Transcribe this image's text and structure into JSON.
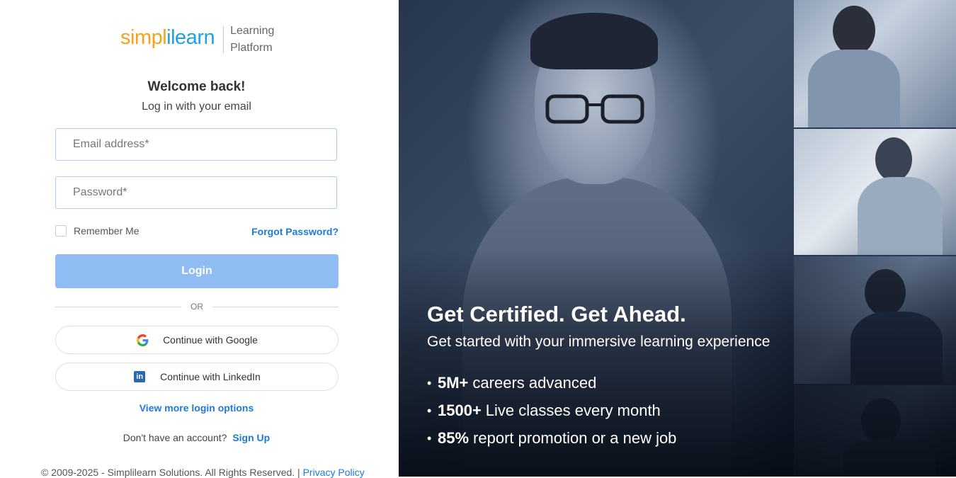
{
  "brand": {
    "logo_orange": "simpl",
    "logo_blue": "ilearn",
    "subtitle_line1": "Learning",
    "subtitle_line2": "Platform",
    "colors": {
      "orange": "#f7a21b",
      "blue": "#1fa2e0",
      "link": "#1d7ad9",
      "login_button": "#8fbcf3"
    }
  },
  "form": {
    "welcome": "Welcome back!",
    "subtitle": "Log in with your email",
    "email_placeholder": "Email address*",
    "email_value": "",
    "password_placeholder": "Password*",
    "password_value": "",
    "remember_label": "Remember Me",
    "remember_checked": false,
    "forgot_label": "Forgot Password?",
    "login_label": "Login",
    "or_label": "OR",
    "google_label": "Continue with Google",
    "google_icon": "google-g-icon",
    "linkedin_label": "Continue with LinkedIn",
    "linkedin_icon": "linkedin-icon",
    "more_options_label": "View more login options",
    "no_account_text": "Don't have an account?",
    "signup_label": "Sign Up"
  },
  "footer": {
    "copyright": "© 2009-2025 - Simplilearn Solutions. All Rights Reserved. |",
    "privacy_label": "Privacy Policy"
  },
  "hero": {
    "title": "Get Certified. Get Ahead.",
    "subtitle": "Get started with your immersive learning experience",
    "stats": [
      {
        "value": "5M+",
        "text": "careers advanced"
      },
      {
        "value": "1500+",
        "text": "Live classes every month"
      },
      {
        "value": "85%",
        "text": "report promotion or a new job"
      }
    ]
  }
}
